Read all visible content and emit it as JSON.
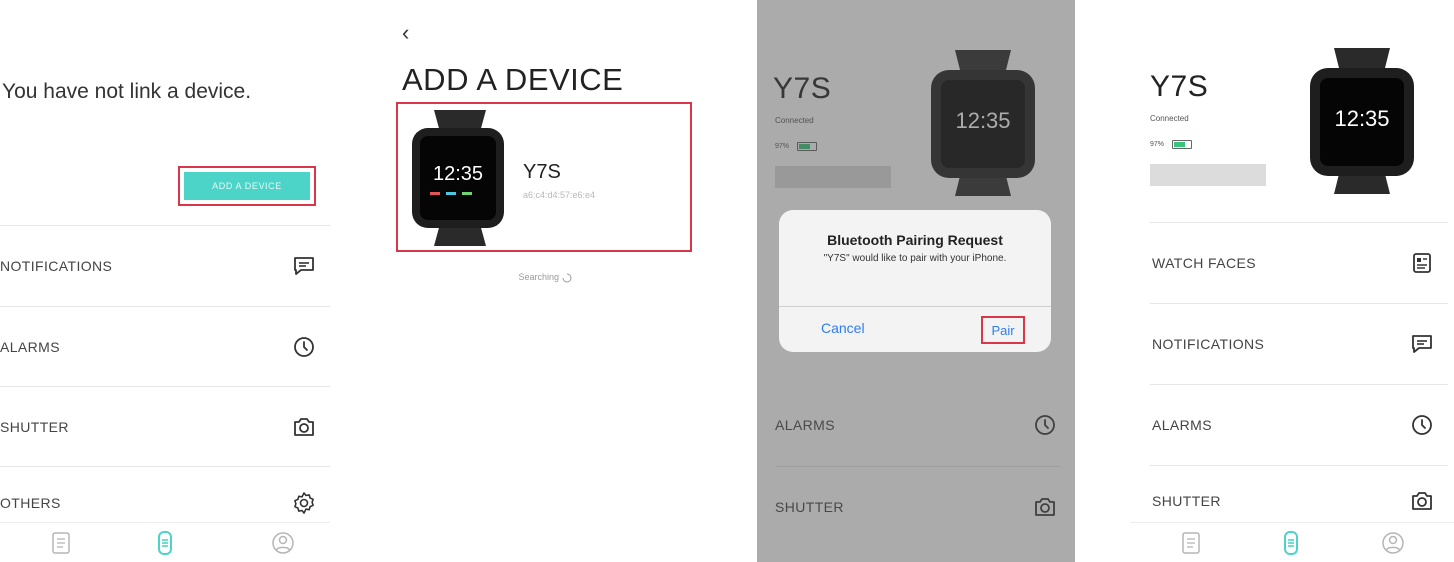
{
  "screen1": {
    "empty_title": "You have not link a device.",
    "add_button": "ADD A DEVICE",
    "menu": [
      {
        "label": "NOTIFICATIONS",
        "icon": "message-icon"
      },
      {
        "label": "ALARMS",
        "icon": "clock-icon"
      },
      {
        "label": "SHUTTER",
        "icon": "camera-icon"
      },
      {
        "label": "OTHERS",
        "icon": "gear-icon"
      }
    ],
    "tabs": [
      "watch-face-tab-icon",
      "device-tab-icon",
      "profile-tab-icon"
    ]
  },
  "screen2": {
    "back": "‹",
    "title": "ADD A DEVICE",
    "device_name": "Y7S",
    "device_mac": "a6:c4:d4:57:e6:e4",
    "watch_time": "12:35",
    "searching": "Searching"
  },
  "screen3": {
    "model": "Y7S",
    "status": "Connected",
    "battery": "97%",
    "watch_time": "12:35",
    "dialog": {
      "title": "Bluetooth Pairing Request",
      "message": "\"Y7S\" would like to pair with your iPhone.",
      "cancel": "Cancel",
      "pair": "Pair"
    },
    "menu": [
      {
        "label": "ALARMS",
        "icon": "clock-icon"
      },
      {
        "label": "SHUTTER",
        "icon": "camera-icon"
      }
    ]
  },
  "screen4": {
    "model": "Y7S",
    "status": "Connected",
    "battery": "97%",
    "watch_time": "12:35",
    "menu": [
      {
        "label": "WATCH FACES",
        "icon": "watch-face-icon"
      },
      {
        "label": "NOTIFICATIONS",
        "icon": "message-icon"
      },
      {
        "label": "ALARMS",
        "icon": "clock-icon"
      },
      {
        "label": "SHUTTER",
        "icon": "camera-icon"
      }
    ]
  },
  "colors": {
    "accent_teal": "#4cd4c8",
    "highlight_red": "#d9364a",
    "ios_blue": "#2f7cf6",
    "battery_green": "#38c47a"
  }
}
